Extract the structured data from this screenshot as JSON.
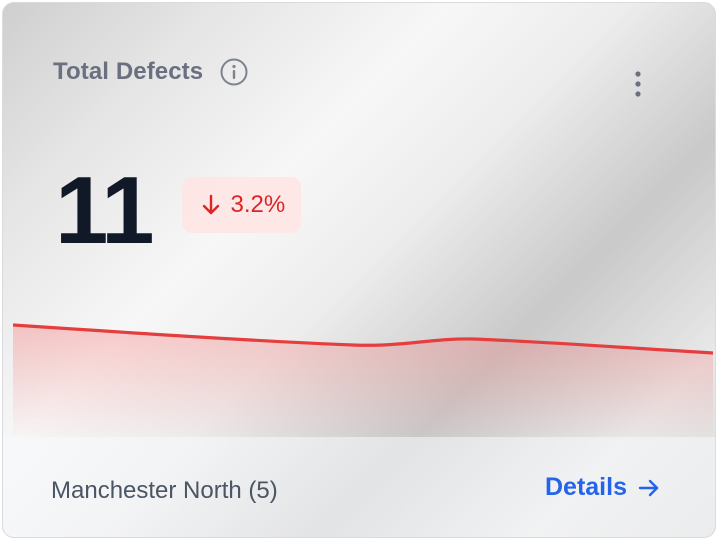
{
  "card": {
    "title": "Total Defects",
    "info_icon": "info-circle-icon",
    "menu_icon": "more-vertical-icon",
    "metric_value": "11",
    "delta": {
      "direction": "down",
      "icon": "arrow-down-icon",
      "text": "3.2%",
      "color": "#dc2626",
      "background": "#fee2e2"
    },
    "sparkline": {
      "color": "#e53e3e"
    },
    "footer": {
      "location": "Manchester North (5)",
      "details_label": "Details",
      "details_icon": "arrow-right-icon",
      "details_color": "#2563eb"
    }
  }
}
